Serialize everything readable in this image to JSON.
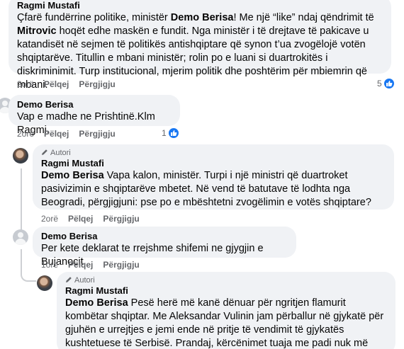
{
  "comments": [
    {
      "author": "Ragmi Mustafi",
      "parts": [
        {
          "t": "Çfarë fundërrine politike, ministër ",
          "b": false
        },
        {
          "t": "Demo Berisa",
          "b": true
        },
        {
          "t": "! Me një “like” ndaj qëndrimit të ",
          "b": false
        },
        {
          "t": "Mitrovic",
          "b": true
        },
        {
          "t": " hoqët edhe maskën e fundit. Nga ministër i të drejtave të pakicave u katandisët në sejmen të politikës antishqiptare që synon t’ua zvogëlojë votën shqiptarëve. Titullin e mbani ministër; rolin po e luani si duartrokitës i diskriminimit. Turp institucional, mjerim politik dhe poshtërim për mbiemrin që mbani.",
          "b": false
        }
      ],
      "time": "2orë",
      "like": "Pëlqej",
      "reply": "Përgjigju",
      "reactions": "5"
    },
    {
      "author": "Demo Berisa",
      "parts": [
        {
          "t": "Vap e madhe ne Prishtinë.Klm Ragmi.",
          "b": false
        }
      ],
      "time": "2orë",
      "like": "Pëlqej",
      "reply": "Përgjigju",
      "reactions": "1"
    },
    {
      "badge": "Autori",
      "author": "Ragmi Mustafi",
      "parts": [
        {
          "t": "Demo Berisa",
          "b": true
        },
        {
          "t": " Vapa kalon, ministër. Turpi i një ministri që duartroket pasivizimin e shqiptarëve mbetet. Në vend të batutave të lodhta nga Beogradi, përgjigjuni: pse po e mbështetni zvogëlimin e votës shqiptare?",
          "b": false
        }
      ],
      "time": "2orë",
      "like": "Pëlqej",
      "reply": "Përgjigju"
    },
    {
      "author": "Demo Berisa",
      "parts": [
        {
          "t": "Per kete deklarat te rrejshme shifemi ne gjygjin e Bujanocit.",
          "b": false
        }
      ],
      "time": "1orë",
      "like": "Pëlqej",
      "reply": "Përgjigju"
    },
    {
      "badge": "Autori",
      "author": "Ragmi Mustafi",
      "parts": [
        {
          "t": "Demo Berisa",
          "b": true
        },
        {
          "t": " Pesë herë më kanë dënuar për ngritjen flamurit kombëtar shqiptar. Me Aleksandar Vulinin jam përballur në gjykatë për gjuhën e urrejtjes e jemi ende në pritje të vendimit të gjykatës kushtetuese të Serbisë. Prandaj, kërcënimet tuaja me padi nuk më bëjnë asnjë përshtypje.",
          "b": false
        }
      ]
    }
  ],
  "icons": {
    "like": "thumbs-up-icon",
    "author_badge": "pencil-icon",
    "avatar": "user-avatar-icon"
  },
  "colors": {
    "bubble": "#f0f2f5",
    "meta": "#65676b",
    "like_blue": "#1877f2"
  }
}
